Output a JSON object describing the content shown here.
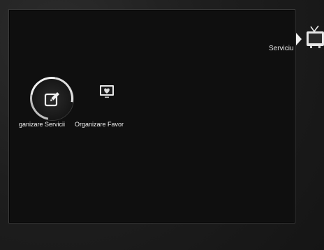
{
  "header": {
    "category_label": "Serviciu"
  },
  "icons": {
    "category": "tv-icon",
    "edit": "edit-icon",
    "favorite": "heart-tv-icon"
  },
  "menu": {
    "items": [
      {
        "label": "ganizare Servicii",
        "icon": "edit-icon",
        "selected": true
      },
      {
        "label": "Organizare Favor",
        "icon": "heart-tv-icon",
        "selected": false
      }
    ]
  },
  "colors": {
    "background": "#1e1e1e",
    "panel": "#0f0f0f",
    "text": "#f2f2f2",
    "highlight": "#f0f0f0"
  }
}
